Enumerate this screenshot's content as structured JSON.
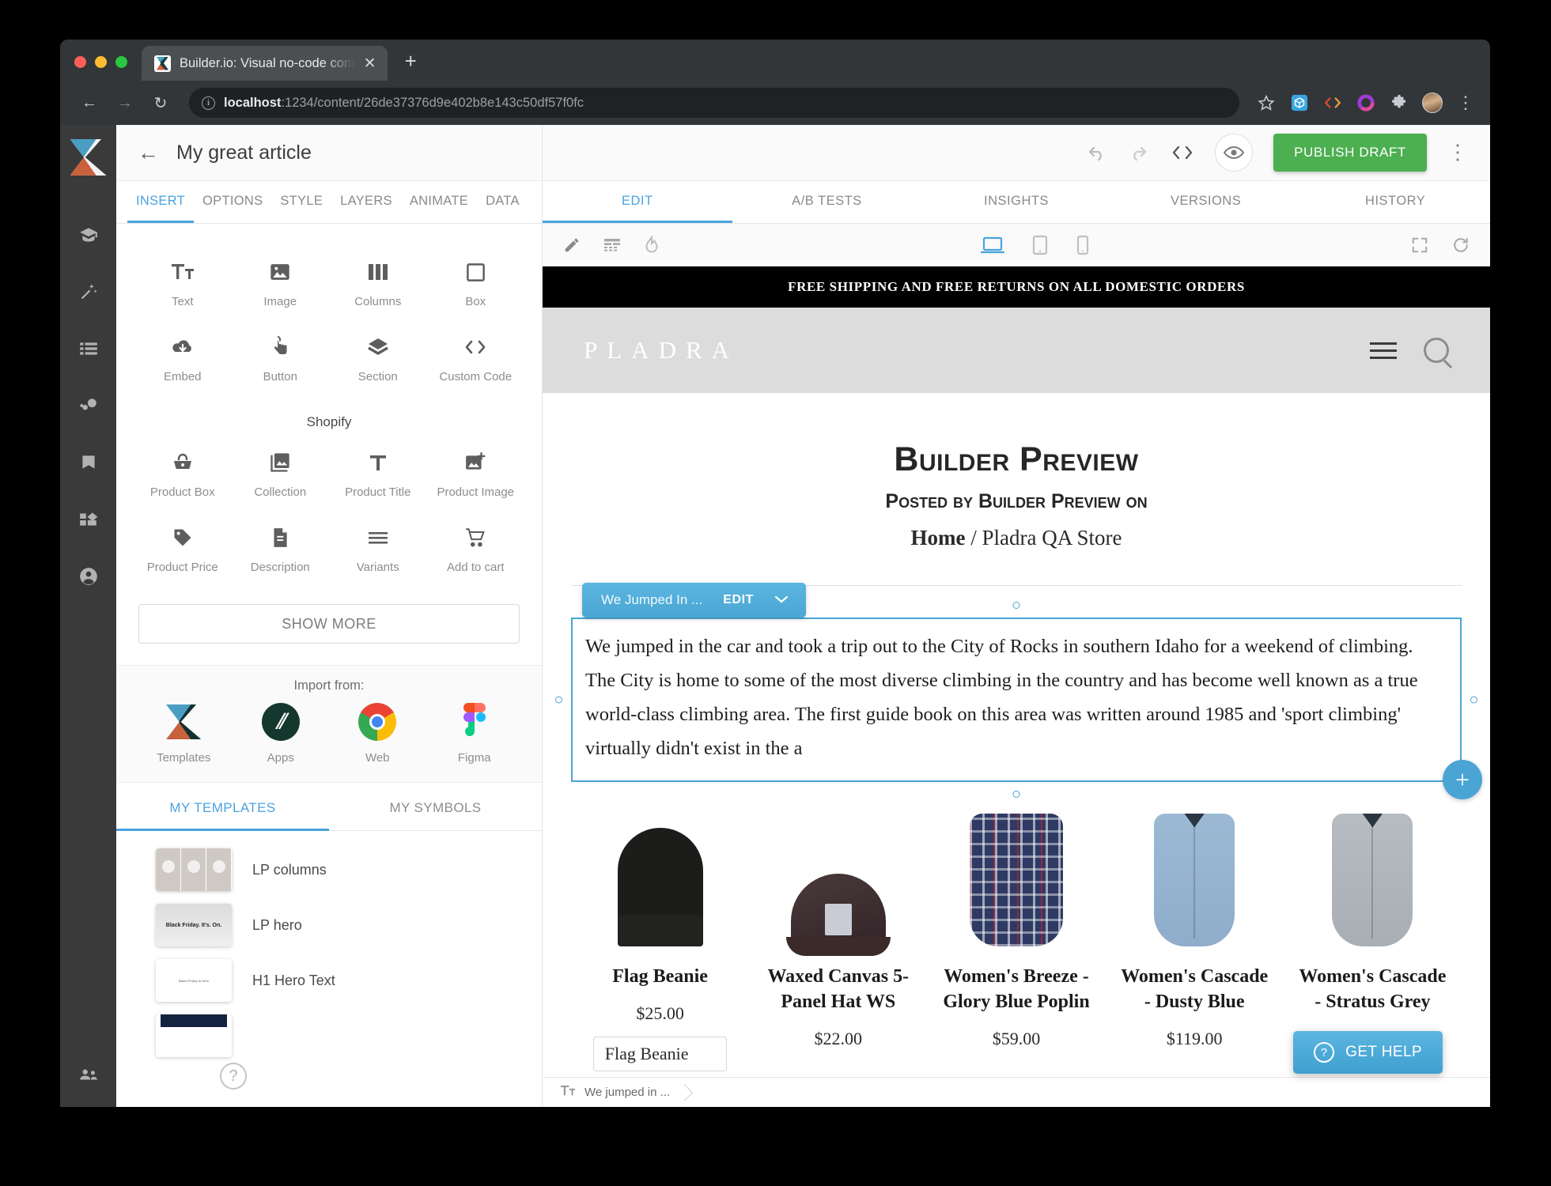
{
  "browser": {
    "tab_title": "Builder.io: Visual no-code cont",
    "new_tab_label": "+",
    "close_label": "✕",
    "url_host": "localhost",
    "url_rest": ":1234/content/26de37376d9e402b8e143c50df57f0fc",
    "back_icon": "←",
    "forward_icon": "→",
    "reload_icon": "↻",
    "star_icon": "☆",
    "kebab_icon": "⋮",
    "extensions": [
      "cube-icon",
      "code-icon",
      "ring-icon",
      "puzzle-icon"
    ]
  },
  "rail": {
    "items": [
      {
        "name": "graduation-cap-icon"
      },
      {
        "name": "magic-wand-icon"
      },
      {
        "name": "list-icon"
      },
      {
        "name": "bubbles-icon"
      },
      {
        "name": "bookmark-icon"
      },
      {
        "name": "blocks-icon"
      },
      {
        "name": "account-icon"
      }
    ],
    "bottom": {
      "name": "people-icon"
    }
  },
  "left_panel": {
    "doc_title": "My great article",
    "back_arrow": "←",
    "tabs": [
      {
        "label": "INSERT",
        "active": true
      },
      {
        "label": "OPTIONS",
        "active": false
      },
      {
        "label": "STYLE",
        "active": false
      },
      {
        "label": "LAYERS",
        "active": false
      },
      {
        "label": "ANIMATE",
        "active": false
      },
      {
        "label": "DATA",
        "active": false
      }
    ],
    "insert_items": [
      {
        "label": "Text",
        "icon": "text-icon"
      },
      {
        "label": "Image",
        "icon": "image-icon"
      },
      {
        "label": "Columns",
        "icon": "columns-icon"
      },
      {
        "label": "Box",
        "icon": "box-icon"
      },
      {
        "label": "Embed",
        "icon": "cloud-download-icon"
      },
      {
        "label": "Button",
        "icon": "tap-icon"
      },
      {
        "label": "Section",
        "icon": "layers-icon"
      },
      {
        "label": "Custom Code",
        "icon": "code-icon"
      }
    ],
    "shopify_title": "Shopify",
    "shopify_items": [
      {
        "label": "Product Box",
        "icon": "basket-icon"
      },
      {
        "label": "Collection",
        "icon": "collection-image-icon"
      },
      {
        "label": "Product Title",
        "icon": "title-t-icon"
      },
      {
        "label": "Product Image",
        "icon": "add-image-icon"
      },
      {
        "label": "Product Price",
        "icon": "tag-icon"
      },
      {
        "label": "Description",
        "icon": "document-icon"
      },
      {
        "label": "Variants",
        "icon": "menu-lines-icon"
      },
      {
        "label": "Add to cart",
        "icon": "cart-icon"
      }
    ],
    "show_more_label": "SHOW MORE",
    "import_label": "Import from:",
    "import_items": [
      {
        "label": "Templates",
        "icon": "builder-logo-icon"
      },
      {
        "label": "Apps",
        "icon": "apps-icon"
      },
      {
        "label": "Web",
        "icon": "chrome-icon"
      },
      {
        "label": "Figma",
        "icon": "figma-icon"
      }
    ],
    "template_tabs": [
      {
        "label": "MY TEMPLATES",
        "active": true
      },
      {
        "label": "MY SYMBOLS",
        "active": false
      }
    ],
    "templates": [
      {
        "name": "LP columns",
        "thumb": "columns-thumb"
      },
      {
        "name": "LP hero",
        "thumb": "hero-thumb",
        "thumb_text": "Black Friday. It's. On."
      },
      {
        "name": "H1 Hero Text",
        "thumb": "plain-thumb",
        "thumb_text": "Black Friday is Here"
      },
      {
        "name": "",
        "thumb": "dark-thumb"
      }
    ],
    "help_icon": "?"
  },
  "editor_header": {
    "undo_icon": "undo-icon",
    "redo_icon": "redo-icon",
    "code_icon": "<>",
    "preview_icon": "eye-icon",
    "publish_label": "PUBLISH DRAFT",
    "publish_color": "#4caf50",
    "kebab_icon": "⋮"
  },
  "editor_tabs": [
    {
      "label": "EDIT",
      "active": true
    },
    {
      "label": "A/B TESTS",
      "active": false
    },
    {
      "label": "INSIGHTS",
      "active": false
    },
    {
      "label": "VERSIONS",
      "active": false
    },
    {
      "label": "HISTORY",
      "active": false
    }
  ],
  "canvas_toolbar": {
    "left": [
      "pencil-icon",
      "wireframe-icon",
      "heat-icon"
    ],
    "devices": [
      {
        "name": "desktop-icon",
        "active": true
      },
      {
        "name": "tablet-icon",
        "active": false
      },
      {
        "name": "mobile-icon",
        "active": false
      }
    ],
    "right": [
      "fullscreen-icon",
      "refresh-icon"
    ]
  },
  "preview": {
    "promo_bar": "FREE SHIPPING AND FREE RETURNS ON ALL DOMESTIC ORDERS",
    "brand": "PLADRA",
    "menu_icon": "hamburger-icon",
    "search_icon": "search-icon",
    "article_title": "Builder Preview",
    "article_sub": "Posted by Builder Preview on",
    "breadcrumb_home": "Home",
    "breadcrumb_sep": "/",
    "breadcrumb_store": "Pladra QA Store",
    "selection": {
      "block_name": "We Jumped In ...",
      "edit_label": "EDIT",
      "chevron": "⌄",
      "body": "We jumped in the car and took a trip out to the City of Rocks in southern Idaho for a weekend of climbing. The City is home to some of the most diverse climbing in the country and has become well known as a true world-class climbing area. The first guide book on this area was written around 1985 and 'sport climbing' virtually didn't exist in the a",
      "accent": "#4aa5d4",
      "add_label": "+"
    },
    "products": [
      {
        "name": "Flag Beanie",
        "price": "$25.00",
        "variant": "Flag Beanie",
        "image": "beanie"
      },
      {
        "name": "Waxed Canvas 5-Panel Hat WS",
        "price": "$22.00",
        "variant": "",
        "image": "cap"
      },
      {
        "name": "Women's Breeze - Glory Blue Poplin",
        "price": "$59.00",
        "variant": "",
        "image": "plaid"
      },
      {
        "name": "Women's Cascade - Dusty Blue",
        "price": "$119.00",
        "variant": "",
        "image": "shirt-blue"
      },
      {
        "name": "Women's Cascade - Stratus Grey",
        "price": "$119.00",
        "variant": "",
        "image": "shirt-grey"
      }
    ],
    "get_help_label": "GET HELP"
  },
  "bottom_bar": {
    "crumb_icon": "text-icon",
    "crumb_label": "We jumped in ..."
  }
}
